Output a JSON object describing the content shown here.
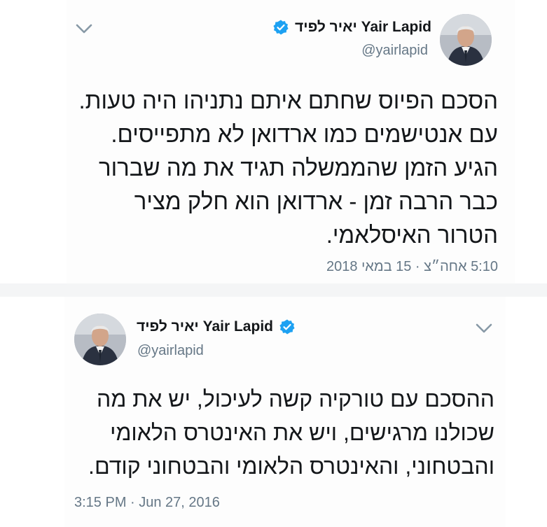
{
  "tweets": [
    {
      "display_name": "יאיר לפיד Yair Lapid",
      "handle": "@yairlapid",
      "lines": [
        "הסכם הפיוס שחתם איתם נתניהו היה טעות.",
        "עם אנטישמים כמו ארדואן לא מתפייסים.",
        "הגיע הזמן שהממשלה תגיד את מה שברור",
        "כבר הרבה זמן - ארדואן הוא חלק מציר",
        "הטרור האיסלאמי."
      ],
      "timestamp": "5:10 אחה״צ · 15 במאי 2018"
    },
    {
      "display_name": "יאיר לפיד Yair Lapid",
      "handle": "@yairlapid",
      "lines": [
        "ההסכם עם טורקיה קשה לעיכול, יש את מה",
        "שכולנו מרגישים, ויש את האינטרס הלאומי",
        "והבטחוני, והאינטרס הלאומי והבטחוני קודם."
      ],
      "timestamp": "3:15 PM · Jun 27, 2016"
    }
  ],
  "colors": {
    "verified": "#1da1f2",
    "text": "#14171a",
    "secondary": "#657786"
  },
  "icons": {
    "verified": "verified-badge-icon",
    "menu": "chevron-down-icon",
    "avatar": "profile-photo"
  }
}
